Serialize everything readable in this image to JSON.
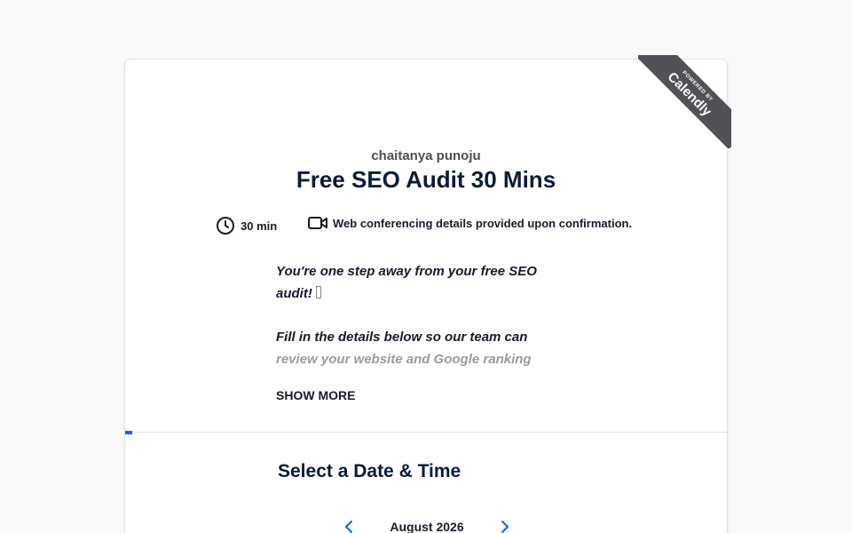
{
  "branding": {
    "powered_by": "POWERED BY",
    "brand": "Calendly"
  },
  "event": {
    "organizer": "chaitanya punoju",
    "title": "Free SEO Audit 30 Mins",
    "duration": "30 min",
    "conferencing": "Web conferencing details provided upon confirmation."
  },
  "description": {
    "line1a": "You're one step away from your free SEO",
    "line1b": "audit!",
    "line2a": "Fill in the details below so our team can",
    "line2b": "review your website and Google ranking",
    "show_more": "SHOW MORE"
  },
  "scheduler": {
    "title": "Select a Date & Time",
    "month": "August 2026"
  },
  "colors": {
    "accent": "#0069ff",
    "ribbon": "#505257"
  },
  "icons": {
    "duration": "clock-icon",
    "conferencing": "video-camera-icon",
    "prev": "chevron-left-icon",
    "next": "chevron-right-icon"
  }
}
